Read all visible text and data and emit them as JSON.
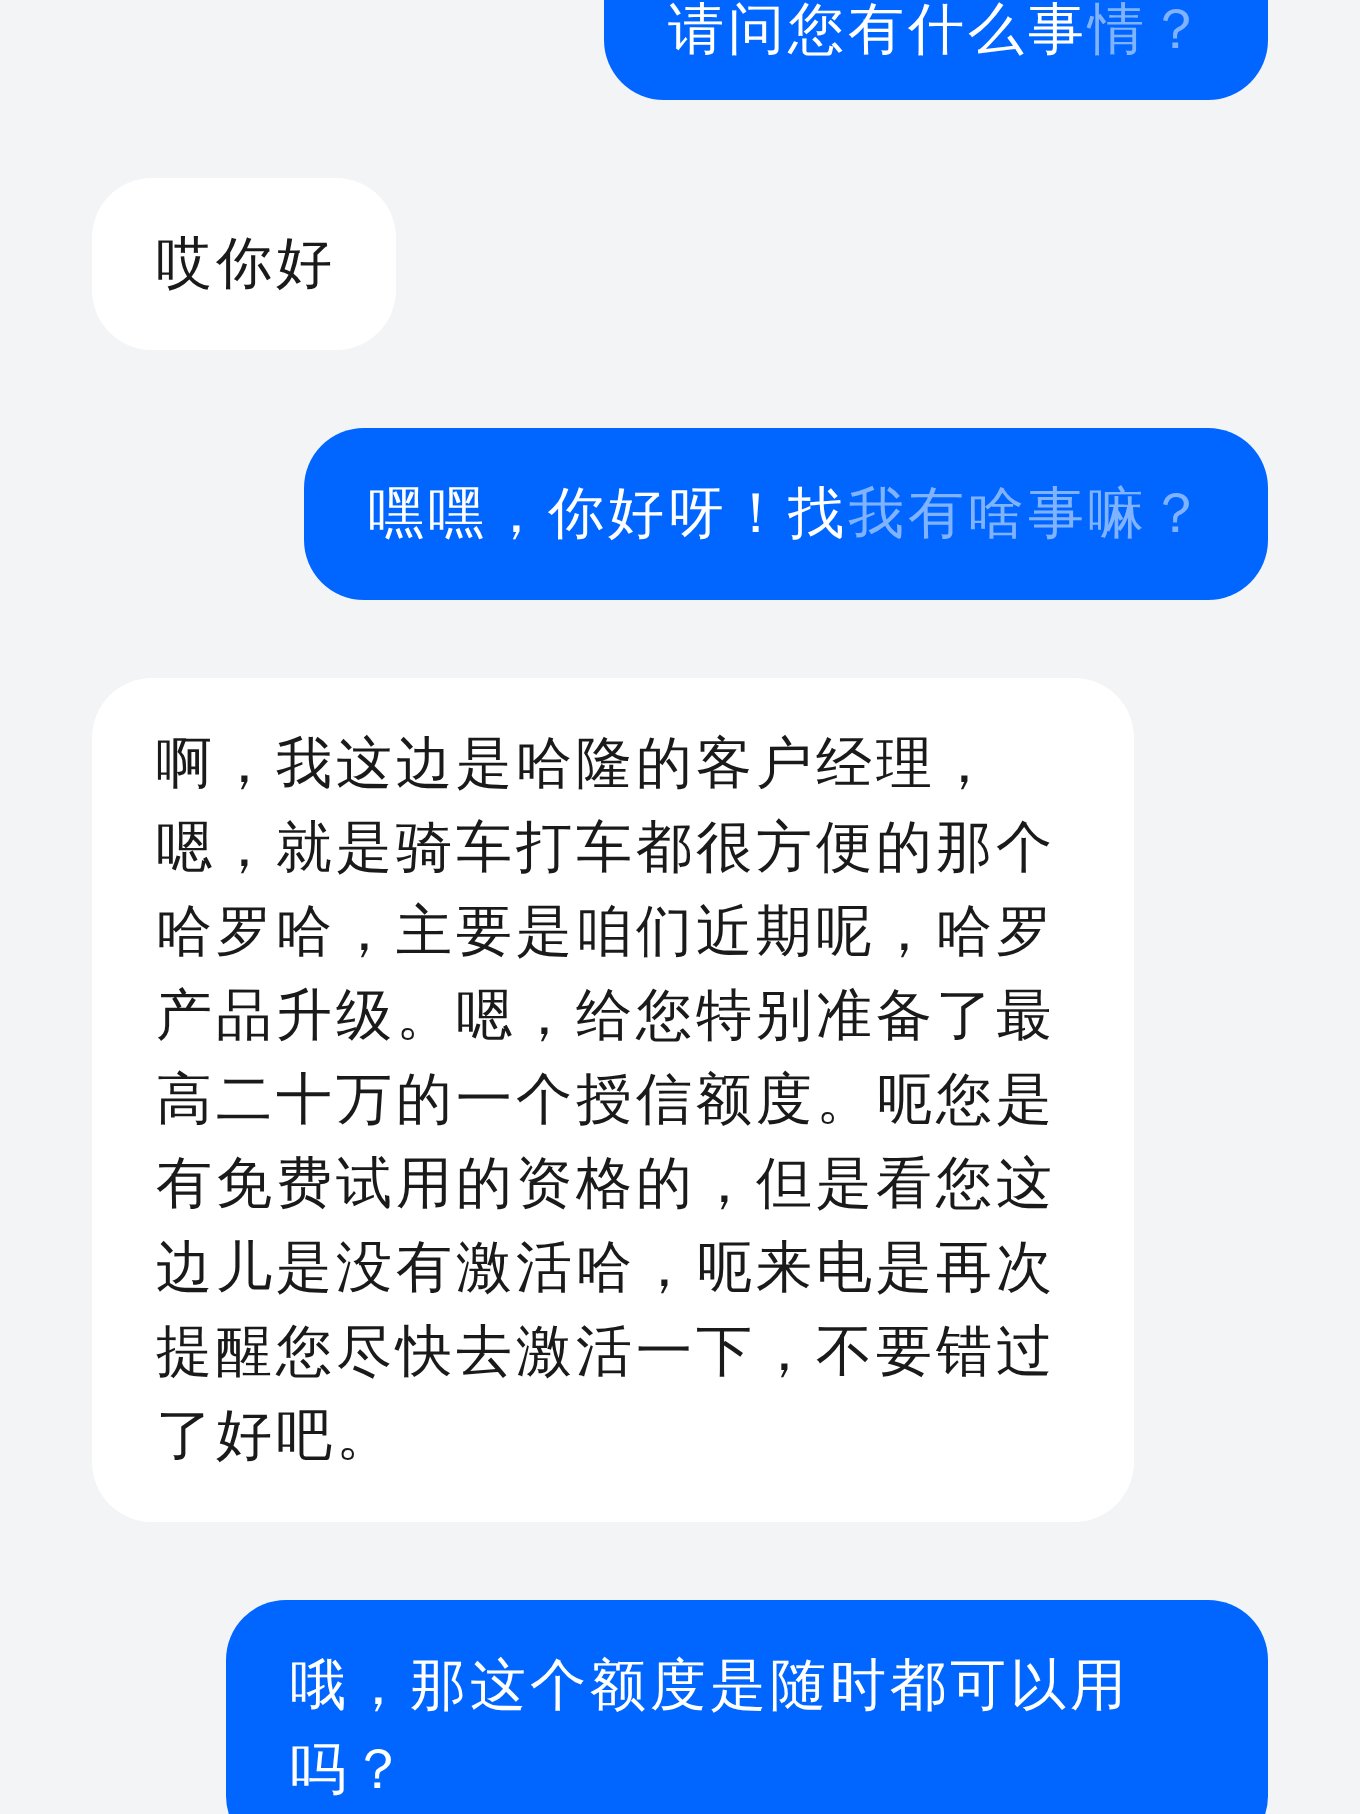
{
  "messages": [
    {
      "kind": "sent",
      "paragraphs": [
        "请问您有什么事"
      ],
      "pending_text": "情？"
    },
    {
      "kind": "received",
      "paragraphs": [
        "哎你好"
      ]
    },
    {
      "kind": "sent",
      "paragraphs": [
        "嘿嘿，你好呀！找"
      ],
      "pending_text": "我有啥事嘛？"
    },
    {
      "kind": "received",
      "paragraphs": [
        "啊，我这边是哈隆的客户经理，",
        "嗯，就是骑车打车都很方便的那个哈罗哈，主要是咱们近期呢，哈罗产品升级。嗯，给您特别准备了最高二十万的一个授信额度。呃您是有免费试用的资格的，但是看您这边儿是没有激活哈，呃来电是再次提醒您尽快去激活一下，不要错过了好吧。"
      ]
    },
    {
      "kind": "sent",
      "paragraphs": [
        "哦，那这个额度是随时都可以用吗？"
      ]
    }
  ]
}
